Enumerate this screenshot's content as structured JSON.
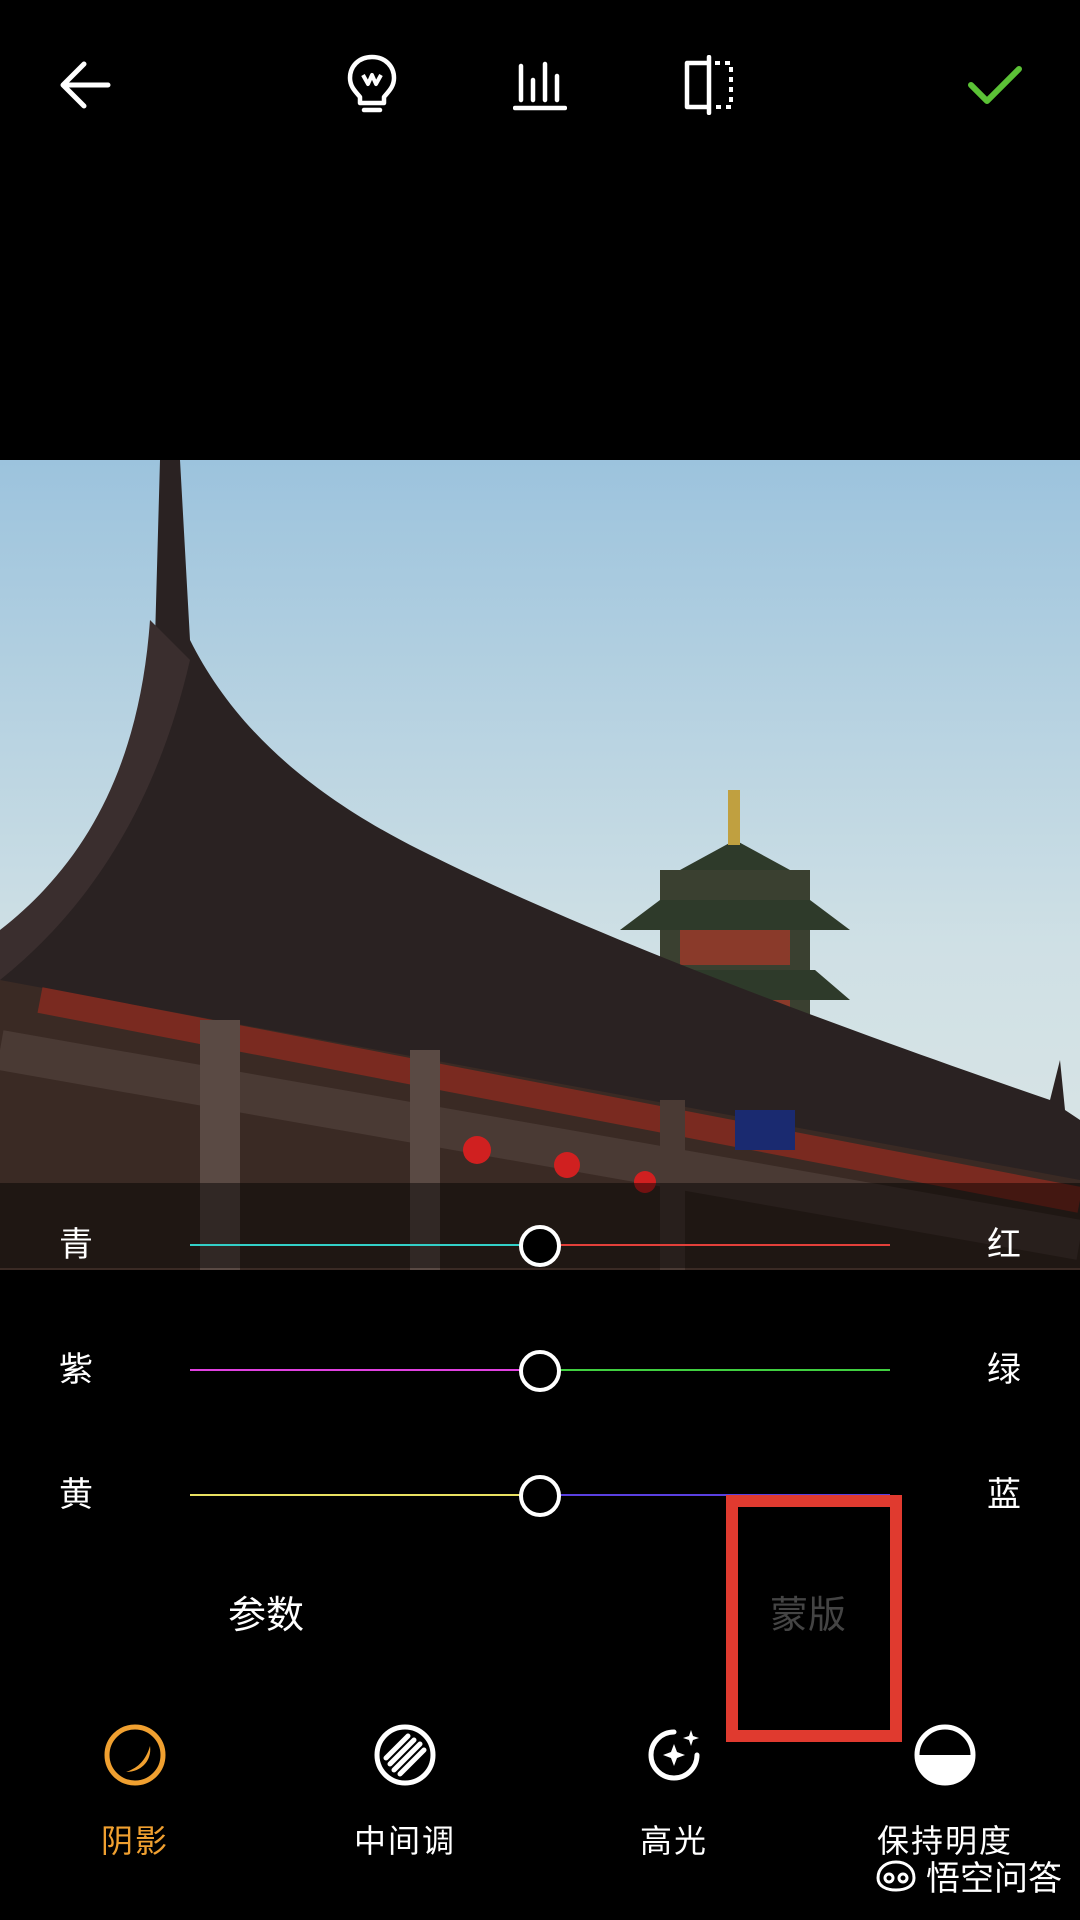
{
  "toolbar": {
    "back_icon": "arrow-left-icon",
    "auto_icon": "lightbulb-icon",
    "histogram_icon": "histogram-icon",
    "compare_icon": "compare-split-icon",
    "confirm_icon": "checkmark-icon",
    "confirm_color": "#5bc236"
  },
  "sliders": [
    {
      "left": "青",
      "right": "红",
      "value": 0.5,
      "left_color": "#33d0c8",
      "right_color": "#e3403a"
    },
    {
      "left": "紫",
      "right": "绿",
      "value": 0.5,
      "left_color": "#e040e0",
      "right_color": "#40d040"
    },
    {
      "left": "黄",
      "right": "蓝",
      "value": 0.5,
      "left_color": "#e8e060",
      "right_color": "#5a40e0"
    }
  ],
  "tabs": {
    "params": "参数",
    "mask": "蒙版"
  },
  "tools": [
    {
      "label": "阴影",
      "icon": "shadow-icon",
      "active": true
    },
    {
      "label": "中间调",
      "icon": "midtone-icon",
      "active": false
    },
    {
      "label": "高光",
      "icon": "highlight-icon",
      "active": false
    },
    {
      "label": "保持明度",
      "icon": "preserve-luminance-icon",
      "active": false
    }
  ],
  "colors": {
    "active": "#f0a030",
    "inactive_tab": "#444444",
    "highlight_box": "#e03a2f"
  },
  "watermark": {
    "text": "悟空问答"
  }
}
